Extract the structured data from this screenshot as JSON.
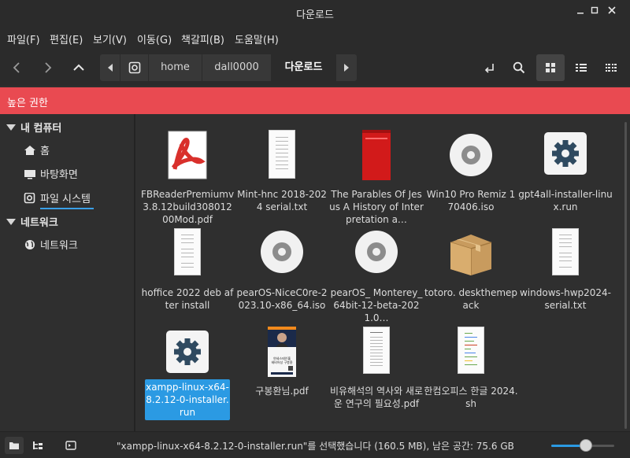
{
  "window": {
    "title": "다운로드"
  },
  "menu": [
    "파일(F)",
    "편집(E)",
    "보기(V)",
    "이동(G)",
    "책갈피(B)",
    "도움말(H)"
  ],
  "breadcrumbs": [
    "home",
    "dall0000",
    "다운로드"
  ],
  "banner": {
    "text": "높은 권한",
    "color": "#e94a51"
  },
  "sidebar": {
    "sections": [
      {
        "label": "내 컴퓨터",
        "items": [
          "홈",
          "바탕화면",
          "파일 시스템"
        ]
      },
      {
        "label": "네트워크",
        "items": [
          "네트워크"
        ]
      }
    ]
  },
  "files": [
    {
      "name": "FBReaderPremiumv3.8.12build30801200Mod.pdf",
      "type": "pdf-icon"
    },
    {
      "name": "Mint-hnc 2018-2024 serial.txt",
      "type": "text-doc"
    },
    {
      "name": "The Parables Of Jesus A History of Interpretation a…",
      "type": "red-book"
    },
    {
      "name": "Win10 Pro Remiz 170406.iso",
      "type": "disc-icon"
    },
    {
      "name": "gpt4all-installer-linux.run",
      "type": "gear-icon"
    },
    {
      "name": "hoffice 2022 deb after install",
      "type": "text-doc"
    },
    {
      "name": "pearOS-NiceC0re-2023.10-x86_64.iso",
      "type": "disc-icon"
    },
    {
      "name": "pearOS_ Monterey_64bit-12-beta-2021.0…",
      "type": "disc-icon"
    },
    {
      "name": "totoro. deskthemepack",
      "type": "package-icon"
    },
    {
      "name": "windows-hwp2024-serial.txt",
      "type": "text-doc"
    },
    {
      "name": "xampp-linux-x64-8.2.12-0-installer.run",
      "type": "gear-icon",
      "selected": true
    },
    {
      "name": "구봉환님.pdf",
      "type": "poster"
    },
    {
      "name": "비유해석의 역사와 새로운 연구의 필요성.pdf",
      "type": "text-doc"
    },
    {
      "name": "한컴오피스 한글 2024.sh",
      "type": "script-doc"
    }
  ],
  "poster_text": {
    "line1": "연세스테인홀",
    "line2": "헤비어성 구봉환"
  },
  "status": {
    "text": "\"xampp-linux-x64-8.2.12-0-installer.run\"를 선택했습니다 (160.5 MB), 남은 공간: 75.6 GB"
  },
  "zoom": {
    "level": 0.55
  },
  "colors": {
    "accent": "#2b9ae3",
    "banner": "#e94a51"
  }
}
